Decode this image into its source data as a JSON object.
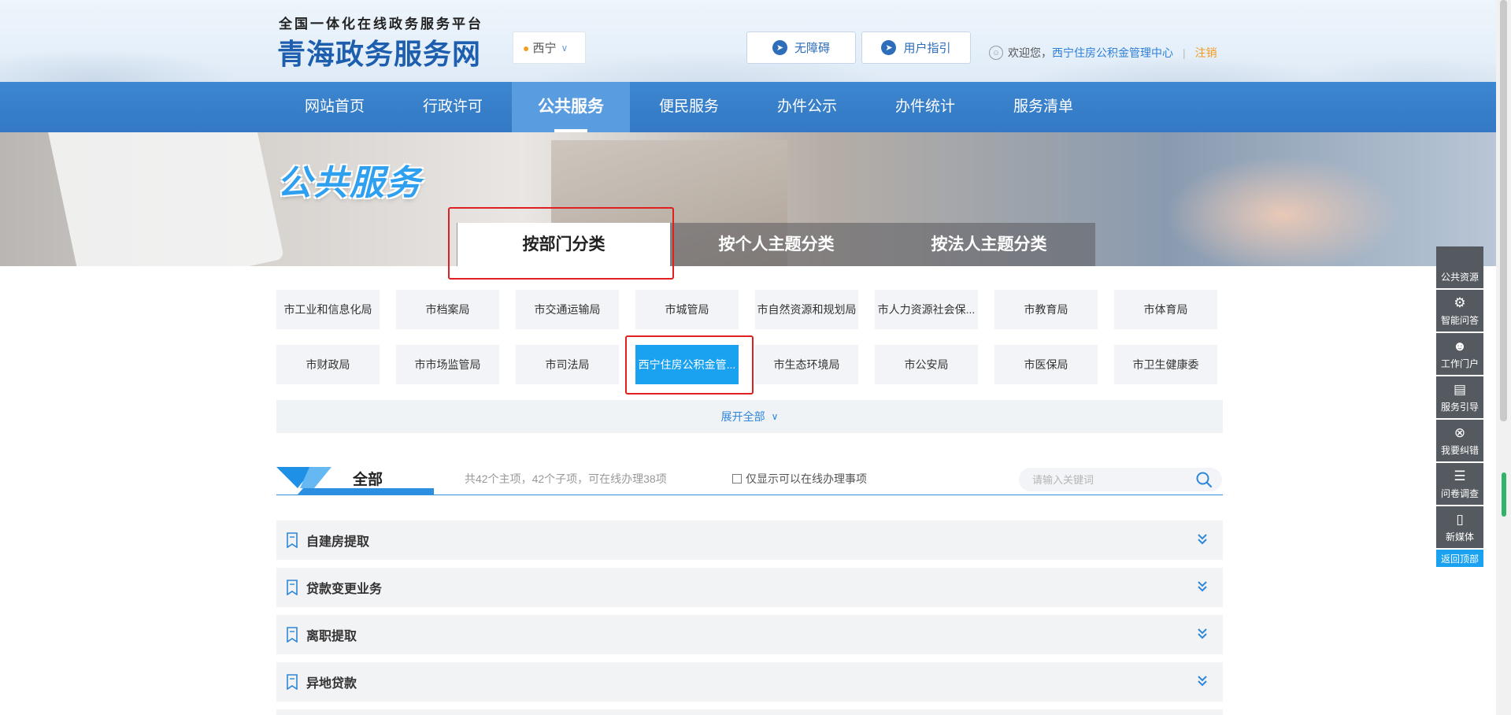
{
  "header": {
    "platform_subtitle": "全国一体化在线政务服务平台",
    "site_name": "青海政务服务网",
    "city": "西宁",
    "accessibility_label": "无障碍",
    "guide_label": "用户指引",
    "welcome_text": "欢迎您，",
    "user_name": "西宁住房公积金管理中心",
    "separator": "|",
    "logout_label": "注销"
  },
  "nav": {
    "items": [
      "网站首页",
      "行政许可",
      "公共服务",
      "便民服务",
      "办件公示",
      "办件统计",
      "服务清单"
    ],
    "active": "公共服务"
  },
  "banner": {
    "title": "公共服务",
    "tabs": [
      "按部门分类",
      "按个人主题分类",
      "按法人主题分类"
    ],
    "active_tab": "按部门分类"
  },
  "departments": {
    "row1": [
      "市工业和信息化局",
      "市档案局",
      "市交通运输局",
      "市城管局",
      "市自然资源和规划局",
      "市人力资源社会保...",
      "市教育局",
      "市体育局"
    ],
    "row2": [
      "市财政局",
      "市市场监管局",
      "市司法局",
      "西宁住房公积金管...",
      "市生态环境局",
      "市公安局",
      "市医保局",
      "市卫生健康委"
    ],
    "selected": "西宁住房公积金管...",
    "expand_label": "展开全部"
  },
  "section": {
    "title": "全部",
    "count_text": "共42个主项，42个子项，可在线办理38项",
    "checkbox_label": "仅显示可以在线办理事项",
    "search_placeholder": "请输入关键词"
  },
  "items": [
    "自建房提取",
    "贷款变更业务",
    "离职提取",
    "异地贷款"
  ],
  "float_toolbar": {
    "items": [
      {
        "label": "公共资源",
        "icon": "resource-icon"
      },
      {
        "label": "智能问答",
        "icon": "robot-icon"
      },
      {
        "label": "工作门户",
        "icon": "person-icon"
      },
      {
        "label": "服务引导",
        "icon": "book-icon"
      },
      {
        "label": "我要纠错",
        "icon": "error-icon"
      },
      {
        "label": "问卷调查",
        "icon": "clipboard-icon"
      },
      {
        "label": "新媒体",
        "icon": "mobile-icon"
      }
    ],
    "back_to_top": "返回顶部"
  },
  "colors": {
    "brand_blue": "#1d5fae",
    "nav_blue": "#3379c4",
    "accent_cyan": "#1aa1f0",
    "highlight_red": "#e02020",
    "logout_orange": "#f39a1e"
  }
}
